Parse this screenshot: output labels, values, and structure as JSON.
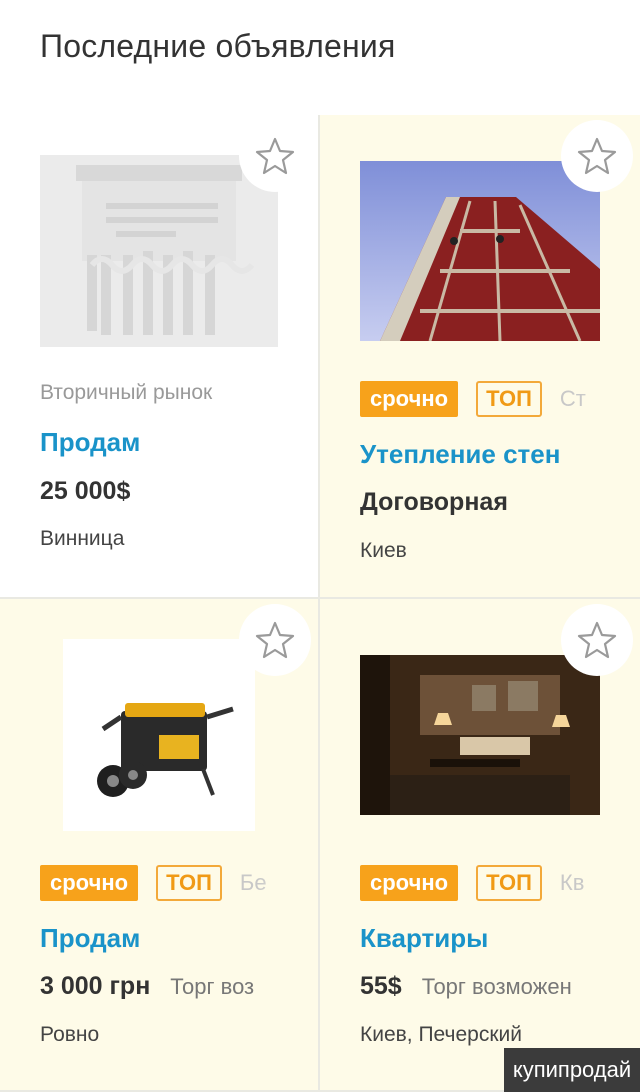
{
  "page": {
    "title": "Последние объявления"
  },
  "icons": {
    "favorite": "star-outline-icon"
  },
  "colors": {
    "accent_blue": "#1a93c9",
    "urgent": "#f7a21b",
    "top": "#f09a16",
    "highlight_bg": "#fefbe8"
  },
  "listings": [
    {
      "category": "Вторичный рынок",
      "title": "Продам",
      "price": "25 000$",
      "city": "Винница"
    },
    {
      "badges": {
        "urgent": "срочно",
        "top": "ТОП",
        "category": "Ст"
      },
      "title": "Утепление стен",
      "price": "Договорная",
      "city": "Киев"
    },
    {
      "badges": {
        "urgent": "срочно",
        "top": "ТОП",
        "category": "Бе"
      },
      "title": "Продам",
      "price": "3 000 грн",
      "haggle": "Торг воз",
      "city": "Ровно"
    },
    {
      "badges": {
        "urgent": "срочно",
        "top": "ТОП",
        "category": "Кв"
      },
      "title": "Квартиры",
      "price": "55$",
      "haggle": "Торг возможен",
      "city": "Киев, Печерский"
    }
  ],
  "watermark": "купипродай"
}
